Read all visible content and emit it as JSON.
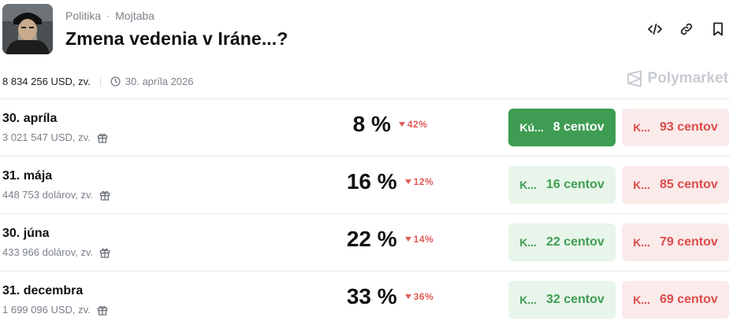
{
  "header": {
    "category": "Politika",
    "separator": "·",
    "subcategory": "Mojtaba",
    "title": "Zmena vedenia v Iráne...?"
  },
  "meta": {
    "volume": "8 834 256 USD, zv.",
    "date": "30. apríla 2026",
    "brand": "Polymarket"
  },
  "markets": [
    {
      "date": "30. apríla",
      "volume": "3 021 547 USD, zv.",
      "percent": "8 %",
      "change": "42%",
      "yes_prefix": "Kú...",
      "yes_price": "8 centov",
      "no_prefix": "K...",
      "no_price": "93 centov",
      "yes_active": true
    },
    {
      "date": "31. mája",
      "volume": "448 753 dolárov, zv.",
      "percent": "16 %",
      "change": "12%",
      "yes_prefix": "K...",
      "yes_price": "16 centov",
      "no_prefix": "K...",
      "no_price": "85 centov",
      "yes_active": false
    },
    {
      "date": "30. júna",
      "volume": "433 966 dolárov, zv.",
      "percent": "22 %",
      "change": "14%",
      "yes_prefix": "K...",
      "yes_price": "22 centov",
      "no_prefix": "K...",
      "no_price": "79 centov",
      "yes_active": false
    },
    {
      "date": "31. decembra",
      "volume": "1 699 096 USD, zv.",
      "percent": "33 %",
      "change": "36%",
      "yes_prefix": "K...",
      "yes_price": "32 centov",
      "no_prefix": "K...",
      "no_price": "69 centov",
      "yes_active": false
    }
  ],
  "colors": {
    "yes": "#3e9d52",
    "yes_bg": "#e8f5ea",
    "no": "#dc4c4b",
    "no_bg": "#fbeaea",
    "down": "#e05a57"
  },
  "icons": [
    "embed-code-icon",
    "link-icon",
    "bookmark-icon",
    "clock-icon",
    "gift-icon",
    "polymarket-logo-icon"
  ]
}
